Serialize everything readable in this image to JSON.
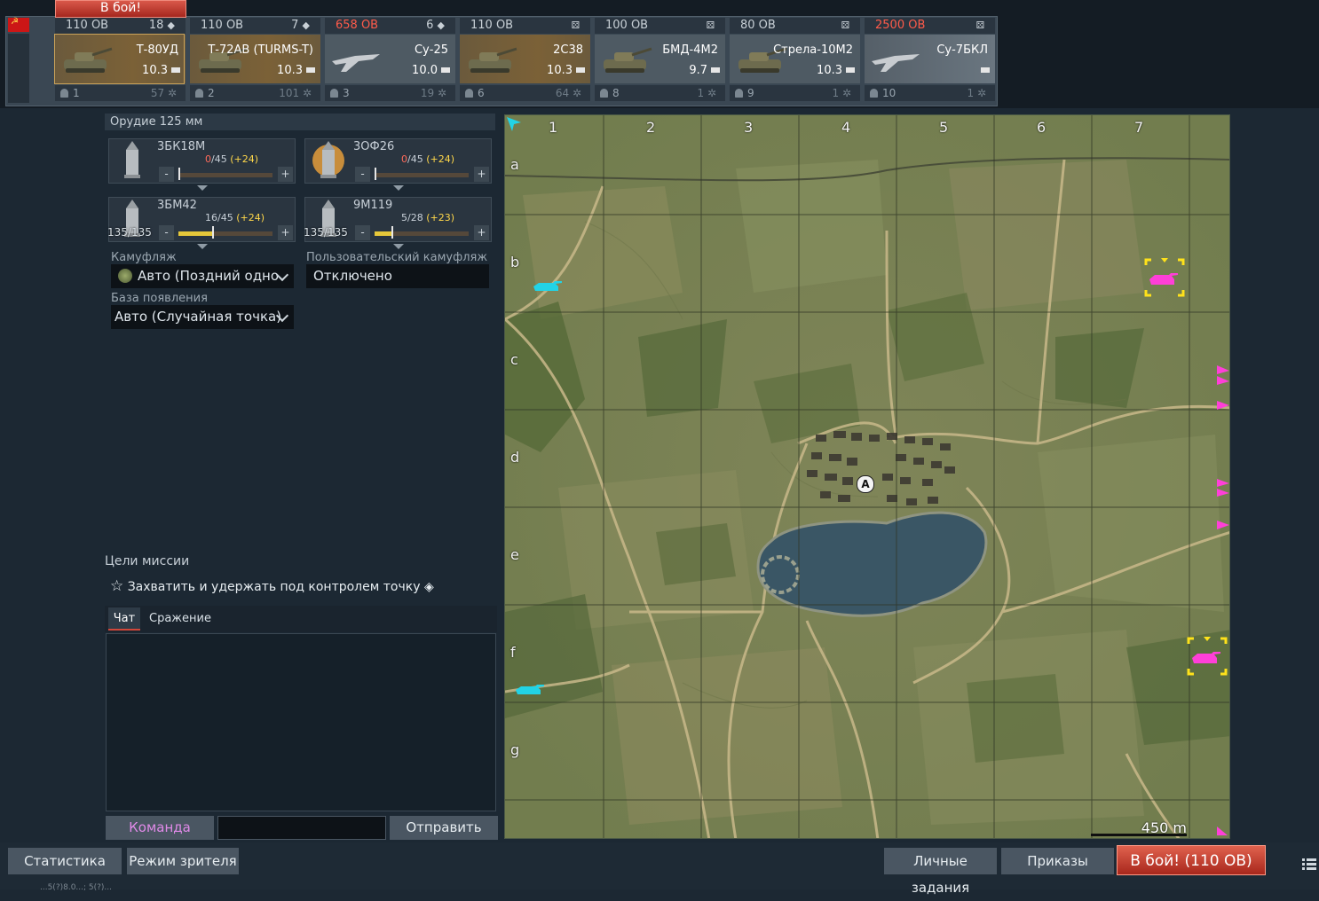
{
  "top": {
    "battle_button": "В бой!",
    "vehicles": [
      {
        "br": "110 ОВ",
        "count": "18",
        "name": "Т-80УД",
        "rank": "10.3",
        "num": "1",
        "crew": "57",
        "selected": true,
        "style": "gold",
        "br_red": false
      },
      {
        "br": "110 ОВ",
        "count": "7",
        "name": "Т-72АВ (TURMS-T)",
        "rank": "10.3",
        "num": "2",
        "crew": "101",
        "selected": false,
        "style": "gold",
        "br_red": false
      },
      {
        "br": "658 ОВ",
        "count": "6",
        "name": "Су-25",
        "rank": "10.0",
        "num": "3",
        "crew": "19",
        "selected": false,
        "style": "plain",
        "br_red": true
      },
      {
        "br": "110 ОВ",
        "count": "",
        "name": "2С38",
        "rank": "10.3",
        "num": "6",
        "crew": "64",
        "selected": false,
        "style": "gold",
        "br_red": false
      },
      {
        "br": "100 ОВ",
        "count": "",
        "name": "БМД-4М2",
        "rank": "9.7",
        "num": "8",
        "crew": "1",
        "selected": false,
        "style": "plain",
        "br_red": false
      },
      {
        "br": "80 ОВ",
        "count": "",
        "name": "Стрела-10М2",
        "rank": "10.3",
        "num": "9",
        "crew": "1",
        "selected": false,
        "style": "plain",
        "br_red": false
      },
      {
        "br": "2500 ОВ",
        "count": "",
        "name": "Су-7БКЛ",
        "rank": "",
        "num": "10",
        "crew": "1",
        "selected": false,
        "style": "prem",
        "br_red": true
      }
    ]
  },
  "loadout": {
    "gun_header": "Орудие 125 мм",
    "ammo": [
      {
        "name": "3БК18М",
        "current": "0",
        "max": "/45",
        "bonus": "(+24)",
        "stock": "",
        "fill_fraction": 0.0,
        "knob_fraction": 0.0,
        "zero": true
      },
      {
        "name": "3ОФ26",
        "current": "0",
        "max": "/45",
        "bonus": "(+24)",
        "stock": "",
        "fill_fraction": 0.0,
        "knob_fraction": 0.0,
        "zero": true
      },
      {
        "name": "3БМ42",
        "current": "16",
        "max": "/45",
        "bonus": "(+24)",
        "stock": "135/135",
        "fill_fraction": 0.36,
        "knob_fraction": 0.36,
        "zero": false
      },
      {
        "name": "9М119",
        "current": "5",
        "max": "/28",
        "bonus": "(+23)",
        "stock": "135/135",
        "fill_fraction": 0.18,
        "knob_fraction": 0.18,
        "zero": false
      }
    ],
    "camo_label": "Камуфляж",
    "camo_value": "Авто (Поздний одно",
    "custom_camo_label": "Пользовательский камуфляж",
    "custom_camo_value": "Отключено",
    "spawn_label": "База появления",
    "spawn_value": "Авто (Случайная точка)"
  },
  "mission": {
    "title": "Цели миссии",
    "objective": "Захватить и удержать под контролем точку"
  },
  "chat": {
    "tab_chat": "Чат",
    "tab_battle": "Сражение",
    "team_button": "Команда",
    "input_placeholder": "",
    "send_button": "Отправить"
  },
  "map": {
    "columns": [
      "1",
      "2",
      "3",
      "4",
      "5",
      "6",
      "7"
    ],
    "rows": [
      "a",
      "b",
      "c",
      "d",
      "e",
      "f",
      "g"
    ],
    "scale": "450 m",
    "capture_point": "A",
    "colors": {
      "ally": "#22d3e6",
      "enemy": "#ff3fd8",
      "target": "#ffe21a"
    }
  },
  "bottom": {
    "stats_button": "Статистика",
    "spectator_button": "Режим зрителя",
    "personal_tasks_button": "Личные задания",
    "orders_button": "Приказы",
    "battle_button": "В бой! (110 ОВ)",
    "status_line": "...5(?)8.0...; 5(?)..."
  }
}
